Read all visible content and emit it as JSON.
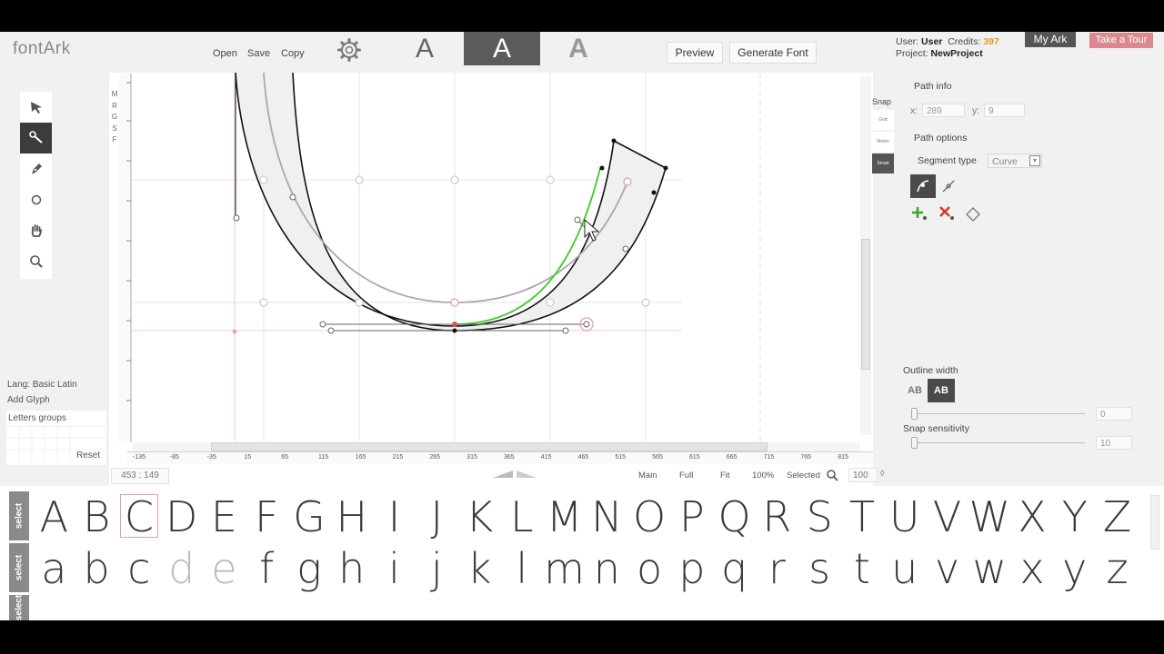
{
  "app": {
    "logo": "fontArk"
  },
  "header": {
    "menu": [
      {
        "label": "Open"
      },
      {
        "label": "Save"
      },
      {
        "label": "Copy"
      }
    ],
    "modes": [
      "A",
      "A",
      "A"
    ],
    "preview_label": "Preview",
    "generate_label": "Generate Font"
  },
  "user": {
    "user_label": "User:",
    "user_name": "User",
    "credits_label": "Credits:",
    "credits_value": "397",
    "project_label": "Project:",
    "project_name": "NewProject",
    "my_ark_label": "My Ark",
    "tour_label": "Take a Tour"
  },
  "left": {
    "lang": "Lang: Basic Latin",
    "add_glyph": "Add Glyph",
    "letters_groups": "Letters groups",
    "reset": "Reset"
  },
  "canvas": {
    "side_letters": [
      "M",
      "R",
      "G",
      "S",
      "F"
    ],
    "snap_title": "Snap",
    "snap_options": [
      "Grid",
      "Metrix",
      "Smart"
    ],
    "ruler_ticks": [
      "-135",
      "-85",
      "-35",
      "15",
      "65",
      "115",
      "165",
      "215",
      "265",
      "315",
      "365",
      "415",
      "465",
      "515",
      "565",
      "615",
      "665",
      "715",
      "765",
      "815"
    ]
  },
  "status": {
    "coords": "453 : 149",
    "views": [
      "Main",
      "Full",
      "Fit",
      "100%",
      "Selected"
    ],
    "zoom_value": "100"
  },
  "path_panel": {
    "path_info": "Path info",
    "x_label": "x:",
    "x_value": "289",
    "y_label": "y:",
    "y_value": "9",
    "path_options": "Path options",
    "segment_label": "Segment type",
    "segment_value": "Curve",
    "outline_label": "Outline width",
    "ab_light": "AB",
    "ab_bold": "AB",
    "outline_value": "0",
    "snap_label": "Snap sensitivity",
    "snap_value": "10"
  },
  "glyph_strip": {
    "select_label": "select",
    "upper": [
      "A",
      "B",
      "C",
      "D",
      "E",
      "F",
      "G",
      "H",
      "I",
      "J",
      "K",
      "L",
      "M",
      "N",
      "O",
      "P",
      "Q",
      "R",
      "S",
      "T",
      "U",
      "V",
      "W",
      "X",
      "Y",
      "Z"
    ],
    "lower": [
      "a",
      "b",
      "c",
      "d",
      "e",
      "f",
      "g",
      "h",
      "i",
      "j",
      "k",
      "l",
      "m",
      "n",
      "o",
      "p",
      "q",
      "r",
      "s",
      "t",
      "u",
      "v",
      "w",
      "x",
      "y",
      "z"
    ],
    "selected": "C"
  },
  "colors": {
    "accent": "#d9898f",
    "credits": "#e39a1c",
    "active_tool": "#3c3c3c",
    "curve_highlight": "#3dcc2a"
  },
  "icons": [
    "arrow-select-icon",
    "node-edit-icon",
    "pen-icon",
    "circle-icon",
    "hand-icon",
    "zoom-icon",
    "gear-icon",
    "search-icon",
    "add-node-icon",
    "delete-node-icon",
    "diamond-icon"
  ]
}
